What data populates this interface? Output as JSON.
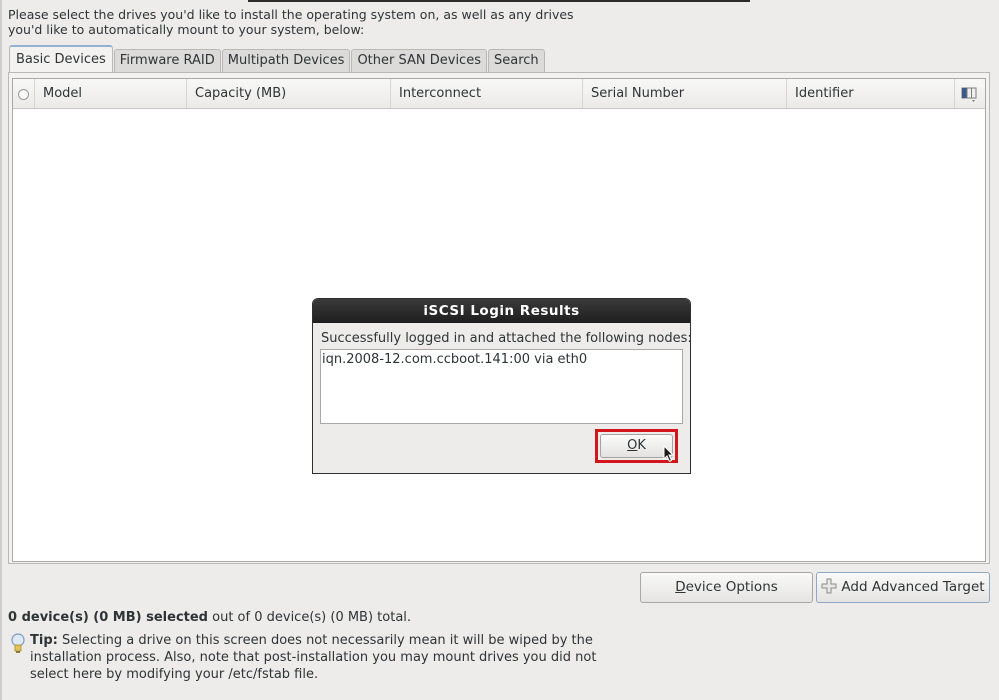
{
  "intro": {
    "line1": "Please select the drives you'd like to install the operating system on, as well as any drives",
    "line2": "you'd like to automatically mount to your system, below:"
  },
  "tabs": [
    {
      "label": "Basic Devices",
      "active": true
    },
    {
      "label": "Firmware RAID",
      "active": false
    },
    {
      "label": "Multipath Devices",
      "active": false
    },
    {
      "label": "Other SAN Devices",
      "active": false
    },
    {
      "label": "Search",
      "active": false
    }
  ],
  "table": {
    "columns": [
      "Model",
      "Capacity (MB)",
      "Interconnect",
      "Serial Number",
      "Identifier"
    ],
    "rows": [],
    "select_all_icon": "radio-icon",
    "column_chooser_icon": "column-chooser-icon"
  },
  "dialog": {
    "title": "iSCSI Login Results",
    "message": "Successfully logged in and attached the following nodes:",
    "nodes": [
      "iqn.2008-12.com.ccboot.141:00 via eth0"
    ],
    "ok_label_mnemonic": "O",
    "ok_label_rest": "K",
    "highlight_color": "#d2161b"
  },
  "buttons": {
    "device_options_mnemonic": "D",
    "device_options_rest": "evice Options",
    "add_target_label": "Add Advanced Target",
    "add_target_icon": "plus-icon"
  },
  "summary": {
    "bold": "0 device(s) (0 MB) selected",
    "rest": " out of 0 device(s) (0 MB) total."
  },
  "tip": {
    "icon": "lightbulb-icon",
    "label": "Tip:",
    "text": " Selecting a drive on this screen does not necessarily mean it will be wiped by the installation process.  Also, note that post-installation you may mount drives you did not select here by modifying your /etc/fstab file."
  }
}
